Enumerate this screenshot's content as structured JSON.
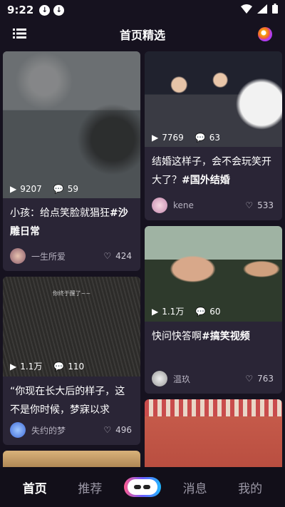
{
  "status": {
    "time": "9:22"
  },
  "header": {
    "title": "首页精选"
  },
  "cards": [
    {
      "plays": "9207",
      "comments": "59",
      "title_text": "小孩：给点笑脸就猖狂",
      "title_tag": "#沙雕日常",
      "author": "一生所爱",
      "likes": "424"
    },
    {
      "plays": "7769",
      "comments": "63",
      "title_text": "结婚这样子，会不会玩笑开大了？",
      "title_tag": "#国外结婚",
      "author": "kene",
      "likes": "533"
    },
    {
      "plays": "1.1万",
      "comments": "110",
      "video_caption": "你终于醒了~~",
      "title_text": "“你现在长大后的样子，这不是你时候，梦寐以求",
      "title_tag": "",
      "author": "失约的梦",
      "likes": "496"
    },
    {
      "plays": "1.1万",
      "comments": "60",
      "title_text": "快问快答啊",
      "title_tag": "#搞笑视频",
      "author": "温玖",
      "likes": "763"
    }
  ],
  "tabbar": {
    "home": "首页",
    "recommend": "推荐",
    "messages": "消息",
    "mine": "我的"
  }
}
